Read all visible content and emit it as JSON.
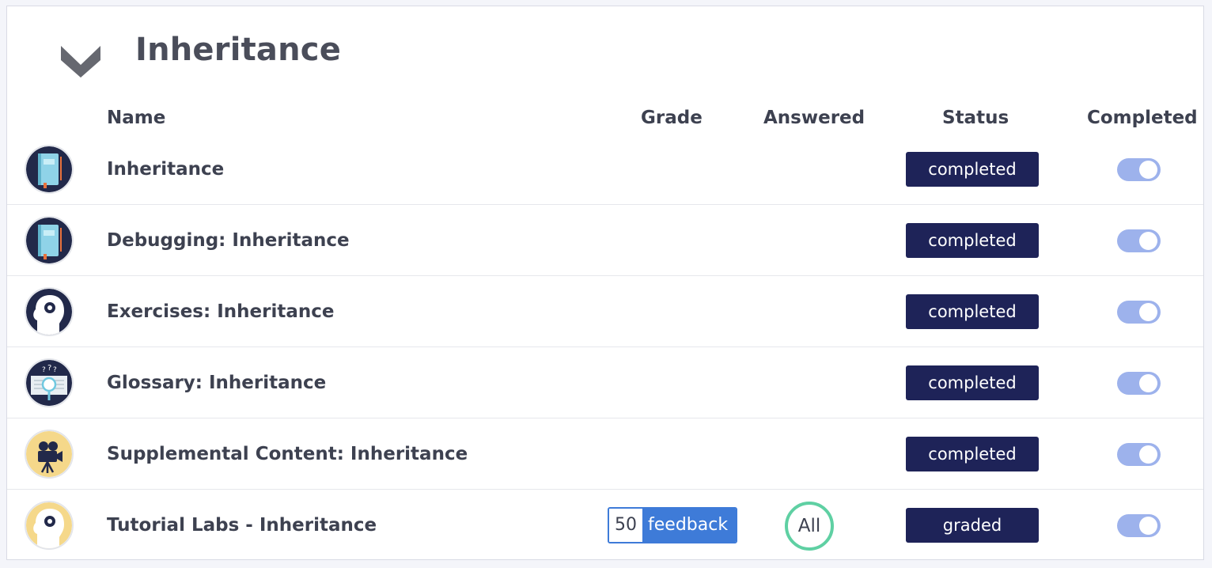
{
  "section": {
    "title": "Inheritance",
    "chevron_icon": "chevron-down-icon"
  },
  "columns": {
    "name": "Name",
    "grade": "Grade",
    "answered": "Answered",
    "status": "Status",
    "completed": "Completed"
  },
  "colors": {
    "status_badge": "#1e2358",
    "toggle_on": "#9db2ec",
    "feedback": "#3e7bd8",
    "answered_ring": "#5fd0a3"
  },
  "rows": [
    {
      "name": "Inheritance",
      "icon": "book-icon",
      "status": "completed",
      "completed": true
    },
    {
      "name": "Debugging: Inheritance",
      "icon": "book-icon",
      "status": "completed",
      "completed": true
    },
    {
      "name": "Exercises: Inheritance",
      "icon": "head-gear-icon",
      "status": "completed",
      "completed": true
    },
    {
      "name": "Glossary: Inheritance",
      "icon": "glossary-icon",
      "status": "completed",
      "completed": true
    },
    {
      "name": "Supplemental Content: Inheritance",
      "icon": "film-camera-icon",
      "status": "completed",
      "completed": true
    },
    {
      "name": "Tutorial Labs - Inheritance",
      "icon": "head-gear-yellow-icon",
      "status": "graded",
      "completed": true,
      "grade": "50",
      "feedback_label": "feedback",
      "answered": "All"
    }
  ]
}
